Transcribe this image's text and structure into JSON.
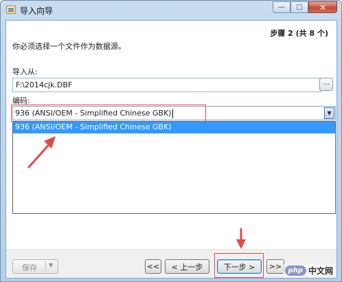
{
  "window": {
    "title": "导入向导"
  },
  "caption": {
    "minimize": "—",
    "maximize": "□",
    "close": "✕"
  },
  "wizard": {
    "step_text": "步骤 2 (共 8 个)",
    "instruction": "你必须选择一个文件作为数据源。",
    "import_from_label": "导入从:",
    "import_from_value": "F:\\2014cjk.DBF",
    "browse_label": "...",
    "encoding_label": "编码:",
    "encoding_value": "936 (ANSI/OEM - Simplified Chinese GBK)",
    "encoding_options": [
      "936 (ANSI/OEM - Simplified Chinese GBK)"
    ]
  },
  "footer": {
    "save_label": "保存",
    "first_label": "<<",
    "prev_label": "< 上一步",
    "next_label": "下一步 >",
    "last_label": ">>"
  },
  "watermark": {
    "badge": "php",
    "text": "中文网"
  },
  "colors": {
    "annotation_red": "#e04a4a",
    "selection_blue": "#3399ff"
  }
}
